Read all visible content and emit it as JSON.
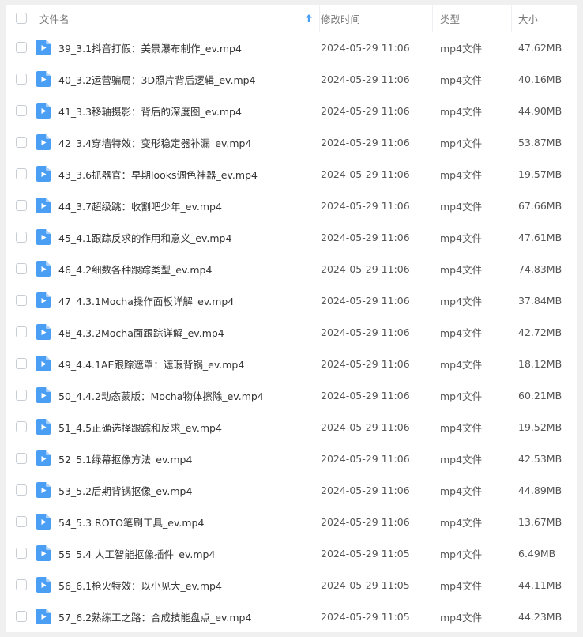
{
  "columns": {
    "name": "文件名",
    "modified": "修改时间",
    "type": "类型",
    "size": "大小"
  },
  "sort": {
    "column": "name",
    "direction": "ascending",
    "icon": "arrow-up-icon"
  },
  "accent_color": "#4a9ff5",
  "files": [
    {
      "name": "39_3.1抖音打假：美景瀑布制作_ev.mp4",
      "modified": "2024-05-29 11:06",
      "type": "mp4文件",
      "size": "47.62MB"
    },
    {
      "name": "40_3.2运营骗局：3D照片背后逻辑_ev.mp4",
      "modified": "2024-05-29 11:06",
      "type": "mp4文件",
      "size": "40.16MB"
    },
    {
      "name": "41_3.3移轴摄影：背后的深度图_ev.mp4",
      "modified": "2024-05-29 11:06",
      "type": "mp4文件",
      "size": "44.90MB"
    },
    {
      "name": "42_3.4穿墙特效：变形稳定器补漏_ev.mp4",
      "modified": "2024-05-29 11:06",
      "type": "mp4文件",
      "size": "53.87MB"
    },
    {
      "name": "43_3.6抓器官：早期looks调色神器_ev.mp4",
      "modified": "2024-05-29 11:06",
      "type": "mp4文件",
      "size": "19.57MB"
    },
    {
      "name": "44_3.7超级跳：收割吧少年_ev.mp4",
      "modified": "2024-05-29 11:06",
      "type": "mp4文件",
      "size": "67.66MB"
    },
    {
      "name": "45_4.1跟踪反求的作用和意义_ev.mp4",
      "modified": "2024-05-29 11:06",
      "type": "mp4文件",
      "size": "47.61MB"
    },
    {
      "name": "46_4.2细数各种跟踪类型_ev.mp4",
      "modified": "2024-05-29 11:06",
      "type": "mp4文件",
      "size": "74.83MB"
    },
    {
      "name": "47_4.3.1Mocha操作面板详解_ev.mp4",
      "modified": "2024-05-29 11:06",
      "type": "mp4文件",
      "size": "37.84MB"
    },
    {
      "name": "48_4.3.2Mocha面跟踪详解_ev.mp4",
      "modified": "2024-05-29 11:06",
      "type": "mp4文件",
      "size": "42.72MB"
    },
    {
      "name": "49_4.4.1AE跟踪遮罩：遮瑕背锅_ev.mp4",
      "modified": "2024-05-29 11:06",
      "type": "mp4文件",
      "size": "18.12MB"
    },
    {
      "name": "50_4.4.2动态蒙版：Mocha物体擦除_ev.mp4",
      "modified": "2024-05-29 11:06",
      "type": "mp4文件",
      "size": "60.21MB"
    },
    {
      "name": "51_4.5正确选择跟踪和反求_ev.mp4",
      "modified": "2024-05-29 11:06",
      "type": "mp4文件",
      "size": "19.52MB"
    },
    {
      "name": "52_5.1绿幕抠像方法_ev.mp4",
      "modified": "2024-05-29 11:06",
      "type": "mp4文件",
      "size": "42.53MB"
    },
    {
      "name": "53_5.2后期背锅抠像_ev.mp4",
      "modified": "2024-05-29 11:06",
      "type": "mp4文件",
      "size": "44.89MB"
    },
    {
      "name": "54_5.3 ROTO笔刷工具_ev.mp4",
      "modified": "2024-05-29 11:06",
      "type": "mp4文件",
      "size": "13.67MB"
    },
    {
      "name": "55_5.4 人工智能抠像插件_ev.mp4",
      "modified": "2024-05-29 11:05",
      "type": "mp4文件",
      "size": "6.49MB"
    },
    {
      "name": "56_6.1枪火特效：以小见大_ev.mp4",
      "modified": "2024-05-29 11:05",
      "type": "mp4文件",
      "size": "44.11MB"
    },
    {
      "name": "57_6.2熟练工之路：合成技能盘点_ev.mp4",
      "modified": "2024-05-29 11:05",
      "type": "mp4文件",
      "size": "44.23MB"
    }
  ]
}
